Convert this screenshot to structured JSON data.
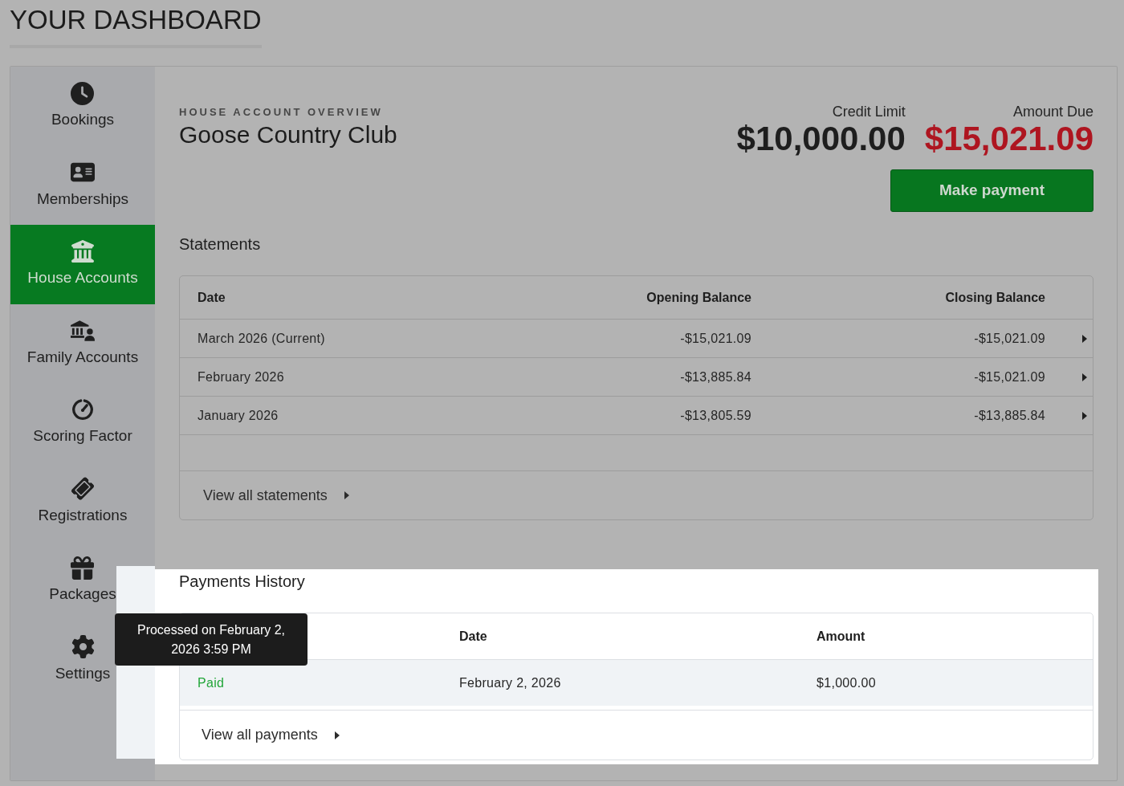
{
  "page_title": "YOUR DASHBOARD",
  "sidebar": {
    "items": [
      {
        "label": "Bookings",
        "selected": false
      },
      {
        "label": "Memberships",
        "selected": false
      },
      {
        "label": "House Accounts",
        "selected": true
      },
      {
        "label": "Family Accounts",
        "selected": false
      },
      {
        "label": "Scoring Factor",
        "selected": false
      },
      {
        "label": "Registrations",
        "selected": false
      },
      {
        "label": "Packages",
        "selected": false
      },
      {
        "label": "Settings",
        "selected": false
      }
    ]
  },
  "overview": {
    "eyebrow": "HOUSE ACCOUNT OVERVIEW",
    "title": "Goose Country Club",
    "summary": [
      {
        "label": "Credit Limit",
        "value": "$10,000.00",
        "kind": "limit"
      },
      {
        "label": "Amount Due",
        "value": "$15,021.09",
        "kind": "due"
      }
    ],
    "action_button": "Make payment"
  },
  "statements": {
    "title": "Statements",
    "columns": [
      "Date",
      "Opening Balance",
      "Closing Balance"
    ],
    "rows": [
      {
        "date": "March 2026 (Current)",
        "opening_balance": "-$15,021.09",
        "closing_balance": "-$15,021.09"
      },
      {
        "date": "February 2026",
        "opening_balance": "-$13,885.84",
        "closing_balance": "-$15,021.09"
      },
      {
        "date": "January 2026",
        "opening_balance": "-$13,805.59",
        "closing_balance": "-$13,885.84"
      }
    ],
    "footer_link": "View all statements"
  },
  "payments_history": {
    "title": "Payments History",
    "columns": [
      "Date",
      "Amount"
    ],
    "rows": [
      {
        "status": "Paid",
        "kind": "paid",
        "date": "February 2, 2026",
        "amount": "$1,000.00"
      }
    ],
    "tooltip": "Processed on February 2, 2026 3:59 PM",
    "footer_link": "View all payments"
  }
}
